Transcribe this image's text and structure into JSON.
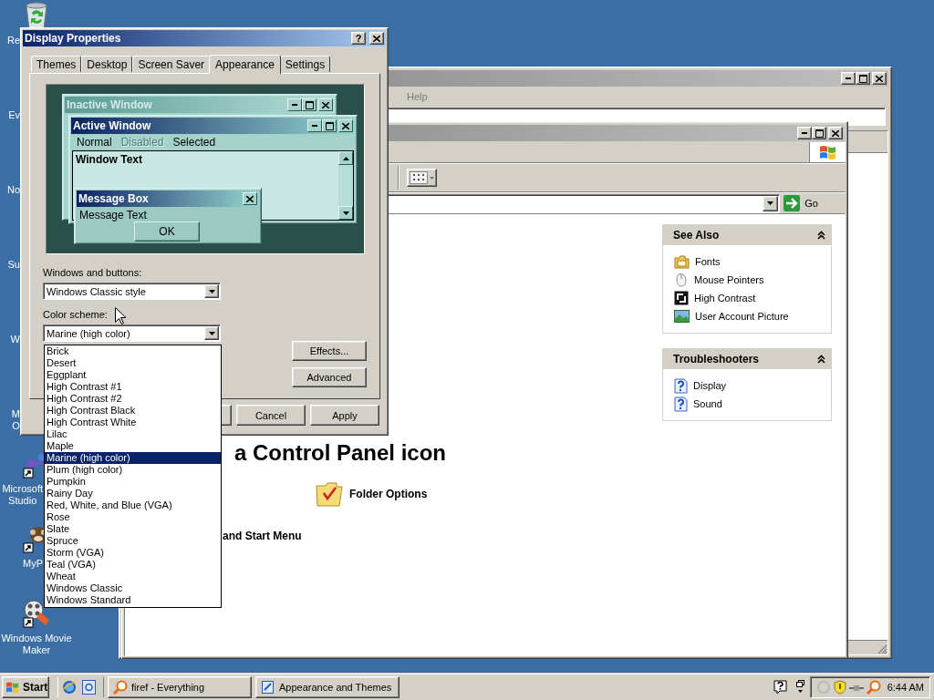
{
  "desktop_icons": [
    {
      "label": "Re"
    },
    {
      "label": "Ev"
    },
    {
      "label": "No"
    },
    {
      "label": "Su"
    },
    {
      "label": "W"
    },
    {
      "label": "M O"
    },
    {
      "label": "Microsoft Studio"
    },
    {
      "label": "MyP"
    },
    {
      "label": "Windows Movie Maker"
    }
  ],
  "explorer_window": {
    "menu": [
      "Help"
    ]
  },
  "control_panel": {
    "go_label": "Go",
    "heading": "a Control Panel icon",
    "tasks": [
      "Folder Options",
      "and Start Menu"
    ],
    "panels": [
      {
        "title": "See Also",
        "items": [
          "Fonts",
          "Mouse Pointers",
          "High Contrast",
          "User Account Picture"
        ]
      },
      {
        "title": "Troubleshooters",
        "items": [
          "Display",
          "Sound"
        ]
      }
    ]
  },
  "display_properties": {
    "title": "Display Properties",
    "help_button": "?",
    "tabs": [
      {
        "label": "Themes",
        "selected": false
      },
      {
        "label": "Desktop",
        "selected": false
      },
      {
        "label": "Screen Saver",
        "selected": false
      },
      {
        "label": "Appearance",
        "selected": true
      },
      {
        "label": "Settings",
        "selected": false
      }
    ],
    "preview": {
      "inactive_title": "Inactive Window",
      "active_title": "Active Window",
      "menu": [
        {
          "label": "Normal",
          "disabled": false
        },
        {
          "label": "Disabled",
          "disabled": true
        },
        {
          "label": "Selected",
          "disabled": false
        }
      ],
      "window_text": "Window Text",
      "message_box_title": "Message Box",
      "message_text": "Message Text",
      "ok_label": "OK"
    },
    "windows_and_buttons": {
      "label": "Windows and buttons:",
      "value": "Windows Classic style"
    },
    "color_scheme": {
      "label": "Color scheme:",
      "value": "Marine (high color)",
      "expanded": true,
      "options": [
        {
          "label": "Brick",
          "selected": false
        },
        {
          "label": "Desert",
          "selected": false
        },
        {
          "label": "Eggplant",
          "selected": false
        },
        {
          "label": "High Contrast #1",
          "selected": false
        },
        {
          "label": "High Contrast #2",
          "selected": false
        },
        {
          "label": "High Contrast Black",
          "selected": false
        },
        {
          "label": "High Contrast White",
          "selected": false
        },
        {
          "label": "Lilac",
          "selected": false
        },
        {
          "label": "Maple",
          "selected": false
        },
        {
          "label": "Marine (high color)",
          "selected": true
        },
        {
          "label": "Plum (high color)",
          "selected": false
        },
        {
          "label": "Pumpkin",
          "selected": false
        },
        {
          "label": "Rainy Day",
          "selected": false
        },
        {
          "label": "Red, White, and Blue (VGA)",
          "selected": false
        },
        {
          "label": "Rose",
          "selected": false
        },
        {
          "label": "Slate",
          "selected": false
        },
        {
          "label": "Spruce",
          "selected": false
        },
        {
          "label": "Storm (VGA)",
          "selected": false
        },
        {
          "label": "Teal (VGA)",
          "selected": false
        },
        {
          "label": "Wheat",
          "selected": false
        },
        {
          "label": "Windows Classic",
          "selected": false
        },
        {
          "label": "Windows Standard",
          "selected": false
        }
      ]
    },
    "side_buttons": [
      "Effects...",
      "Advanced"
    ],
    "footer_buttons": [
      "Cancel",
      "Apply"
    ]
  },
  "taskbar": {
    "start_label": "Start",
    "tasks": [
      "firef - Everything",
      "Appearance and Themes"
    ],
    "clock": "6:44 AM"
  }
}
